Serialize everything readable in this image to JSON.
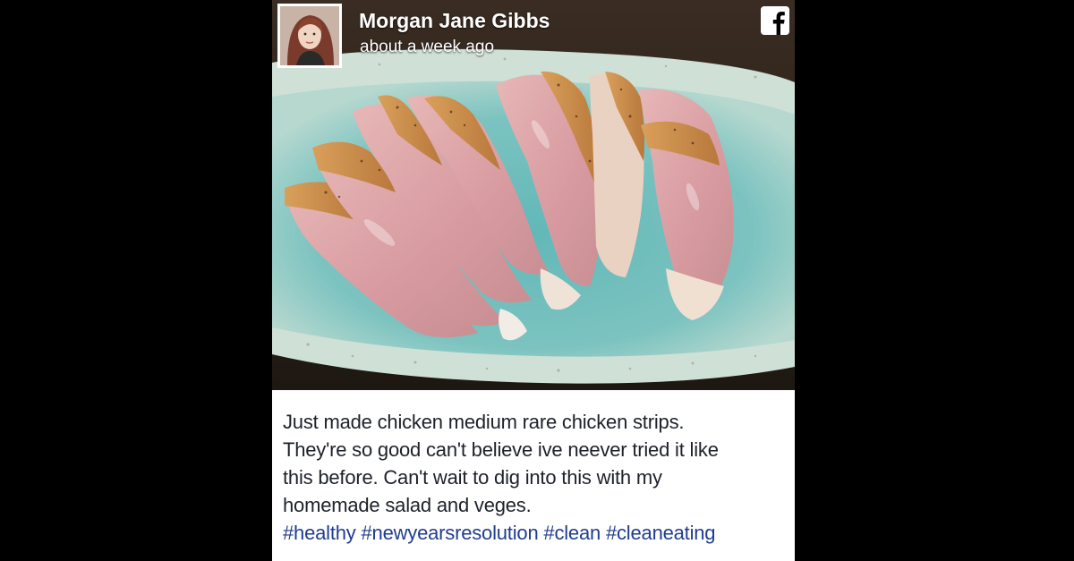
{
  "post": {
    "author_name": "Morgan Jane Gibbs",
    "timestamp": "about a week ago",
    "caption_lines": [
      "Just made chicken medium rare chicken strips.",
      "They're so good can't believe ive neever tried it like",
      "this before. Can't wait to dig into this with my",
      "homemade salad and veges."
    ],
    "hashtags": [
      "#healthy",
      "#newyearsresolution",
      "#clean",
      "#cleaneating"
    ],
    "platform_icon": "facebook-icon"
  },
  "colors": {
    "page_background": "#000000",
    "card_background": "#ffffff",
    "text": "#1d2129",
    "hashtag": "#1f3d8f",
    "plate": "#7fc3c0",
    "chicken_pink": "#d9a4a8",
    "seared_edge": "#c98b4c"
  }
}
